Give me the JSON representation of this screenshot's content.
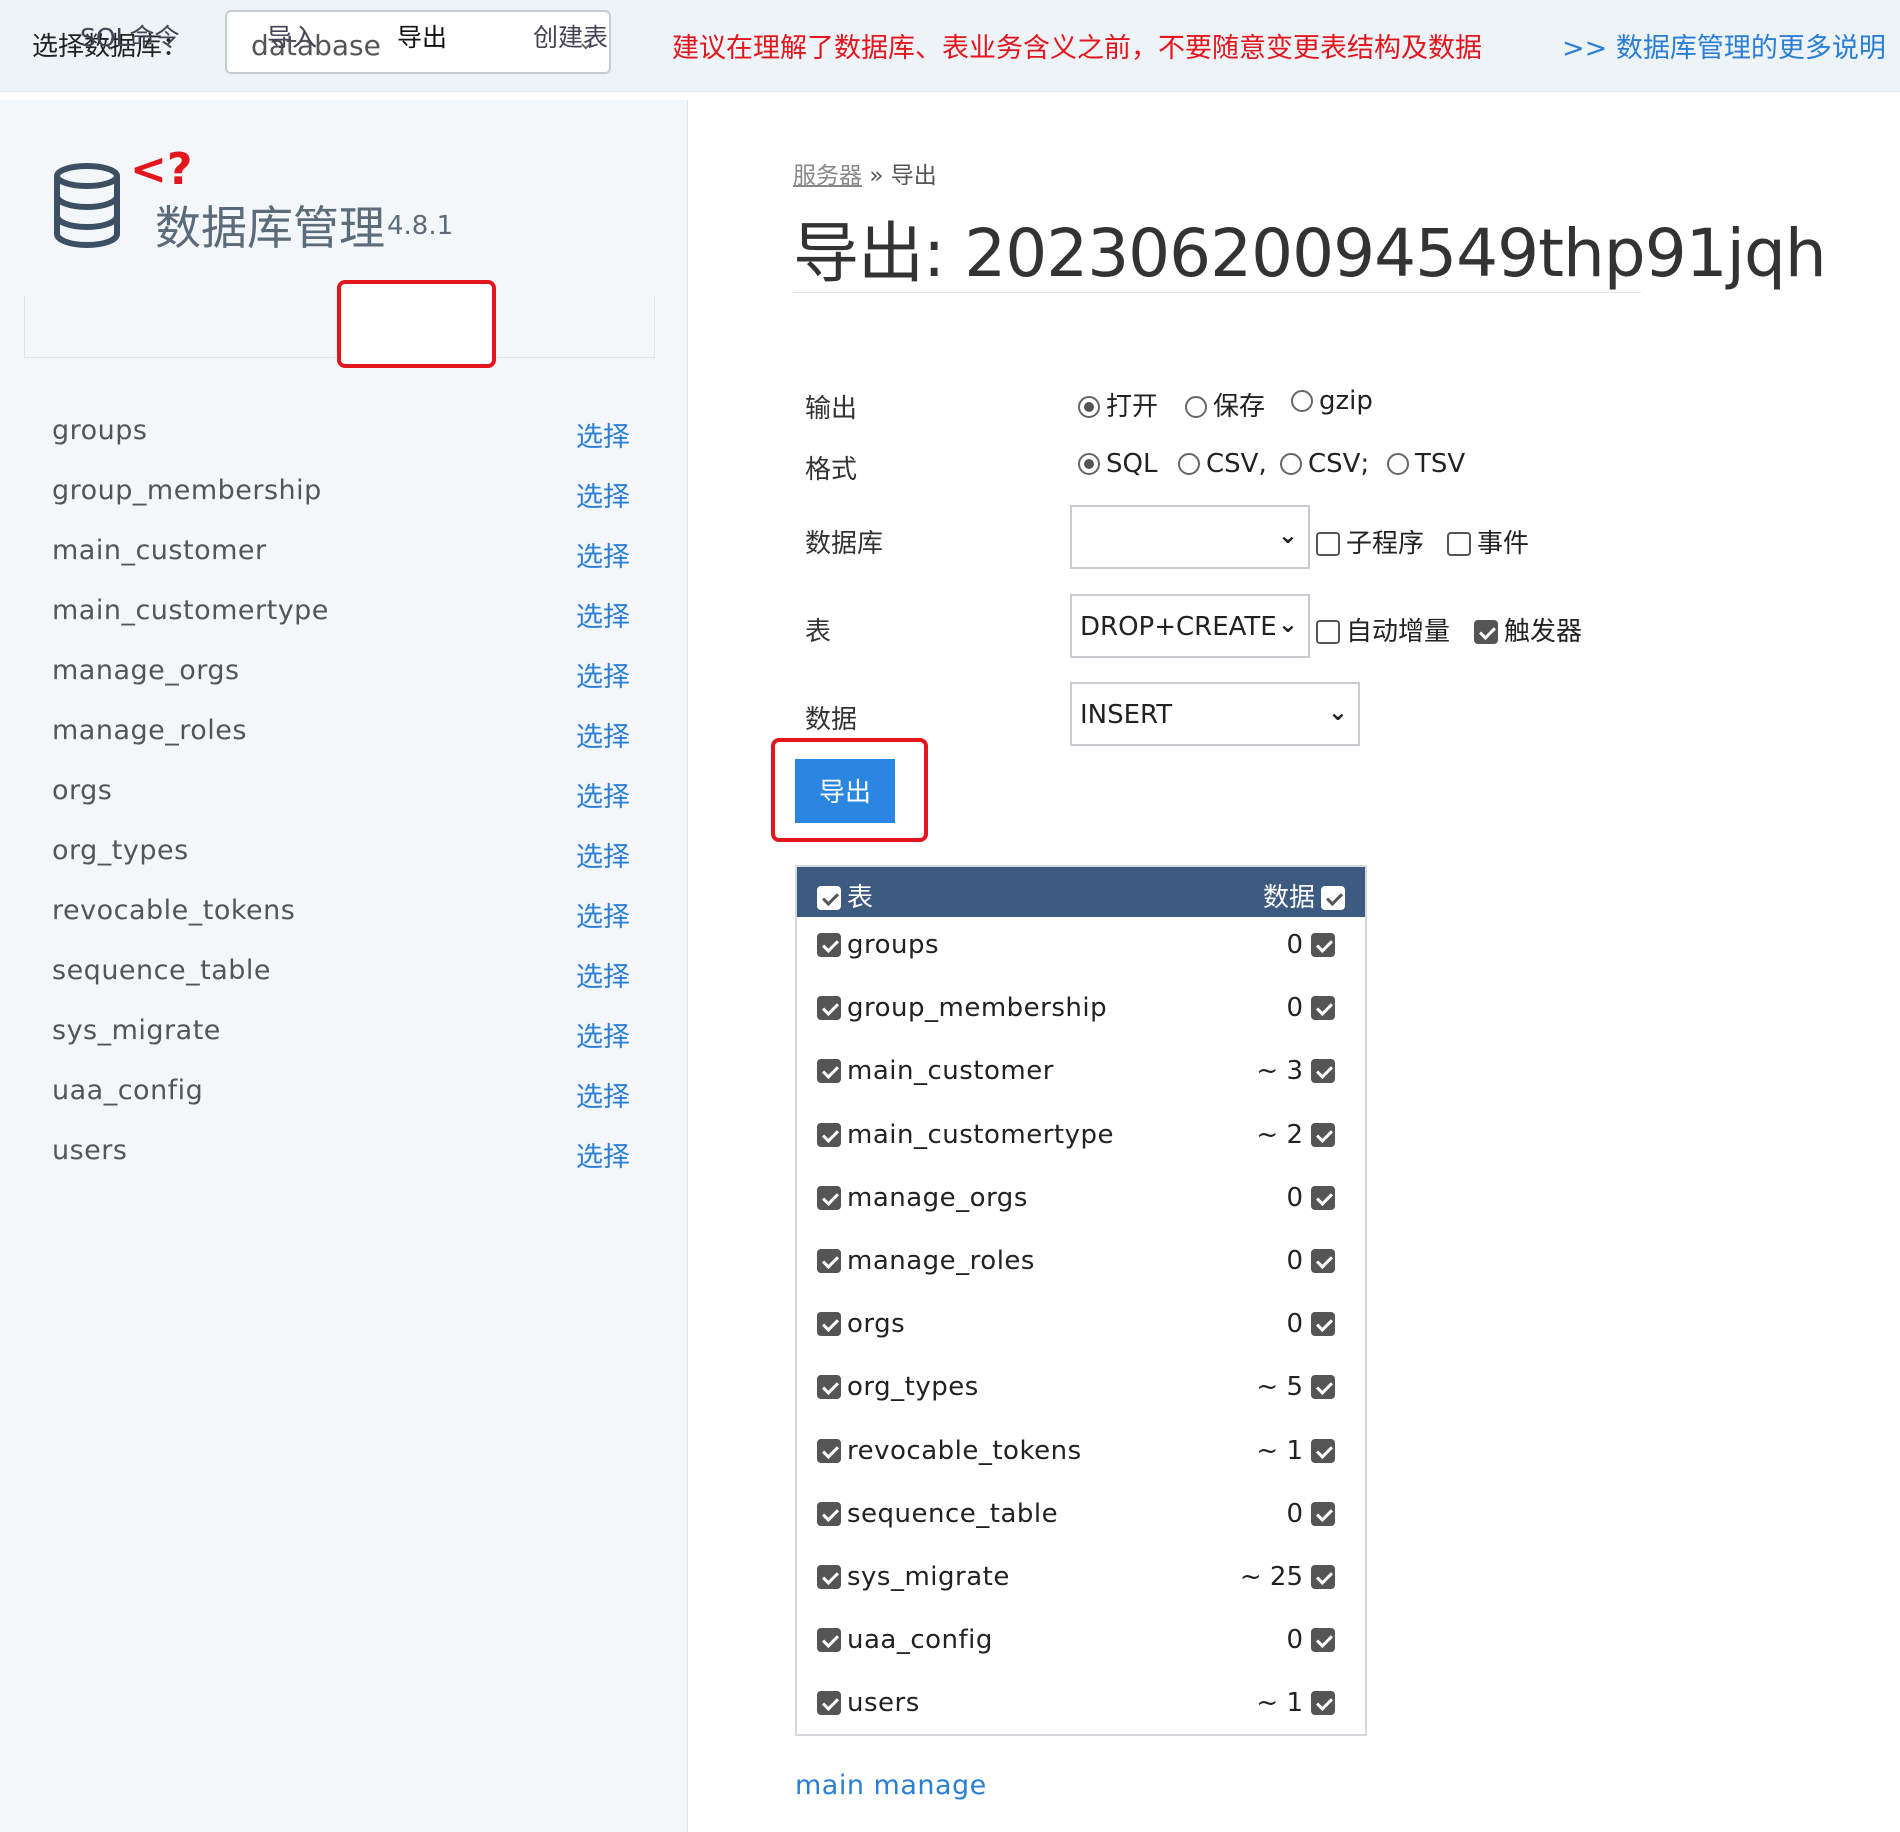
{
  "topbar": {
    "label": "选择数据库：",
    "db_select_value": "database",
    "warning": "建议在理解了数据库、表业务含义之前，不要随意变更表结构及数据",
    "more_link": ">> 数据库管理的更多说明"
  },
  "sidebar": {
    "logo_tag": "<?",
    "app_title": "数据库管理",
    "version": "4.8.1",
    "tabs": [
      {
        "label": "SQL命令"
      },
      {
        "label": "导入"
      },
      {
        "label": "导出"
      },
      {
        "label": "创建表"
      }
    ],
    "pick_label": "选择",
    "tables": [
      "groups",
      "group_membership",
      "main_customer",
      "main_customertype",
      "manage_orgs",
      "manage_roles",
      "orgs",
      "org_types",
      "revocable_tokens",
      "sequence_table",
      "sys_migrate",
      "uaa_config",
      "users"
    ]
  },
  "main": {
    "breadcrumb": {
      "link": "服务器",
      "sep": "»",
      "current": "导出"
    },
    "title": "导出: 20230620094549thp91jqh",
    "form": {
      "output_label": "输出",
      "output_options": [
        "打开",
        "保存",
        "gzip"
      ],
      "output_selected": "打开",
      "format_label": "格式",
      "format_options": [
        "SQL",
        "CSV,",
        "CSV;",
        "TSV"
      ],
      "format_selected": "SQL",
      "database_label": "数据库",
      "database_value": "",
      "routines_label": "子程序",
      "events_label": "事件",
      "table_label": "表",
      "table_value": "DROP+CREATE",
      "auto_increment_label": "自动增量",
      "triggers_label": "触发器",
      "data_label": "数据",
      "data_value": "INSERT"
    },
    "export_button": "导出",
    "export_table": {
      "header_left": "表",
      "header_right": "数据",
      "rows": [
        {
          "name": "groups",
          "count": "0"
        },
        {
          "name": "group_membership",
          "count": "0"
        },
        {
          "name": "main_customer",
          "count": "~ 3"
        },
        {
          "name": "main_customertype",
          "count": "~ 2"
        },
        {
          "name": "manage_orgs",
          "count": "0"
        },
        {
          "name": "manage_roles",
          "count": "0"
        },
        {
          "name": "orgs",
          "count": "0"
        },
        {
          "name": "org_types",
          "count": "~ 5"
        },
        {
          "name": "revocable_tokens",
          "count": "~ 1"
        },
        {
          "name": "sequence_table",
          "count": "0"
        },
        {
          "name": "sys_migrate",
          "count": "~ 25"
        },
        {
          "name": "uaa_config",
          "count": "0"
        },
        {
          "name": "users",
          "count": "~ 1"
        }
      ]
    },
    "footer_link": "main manage"
  },
  "colors": {
    "accent": "#2a86e0",
    "warning": "#e3161d",
    "table_header": "#3d5a80",
    "sidebar_bg": "#f4f7fa"
  },
  "icons": [
    "database-icon",
    "chevron-down-icon",
    "checkbox-icon",
    "radio-icon"
  ]
}
